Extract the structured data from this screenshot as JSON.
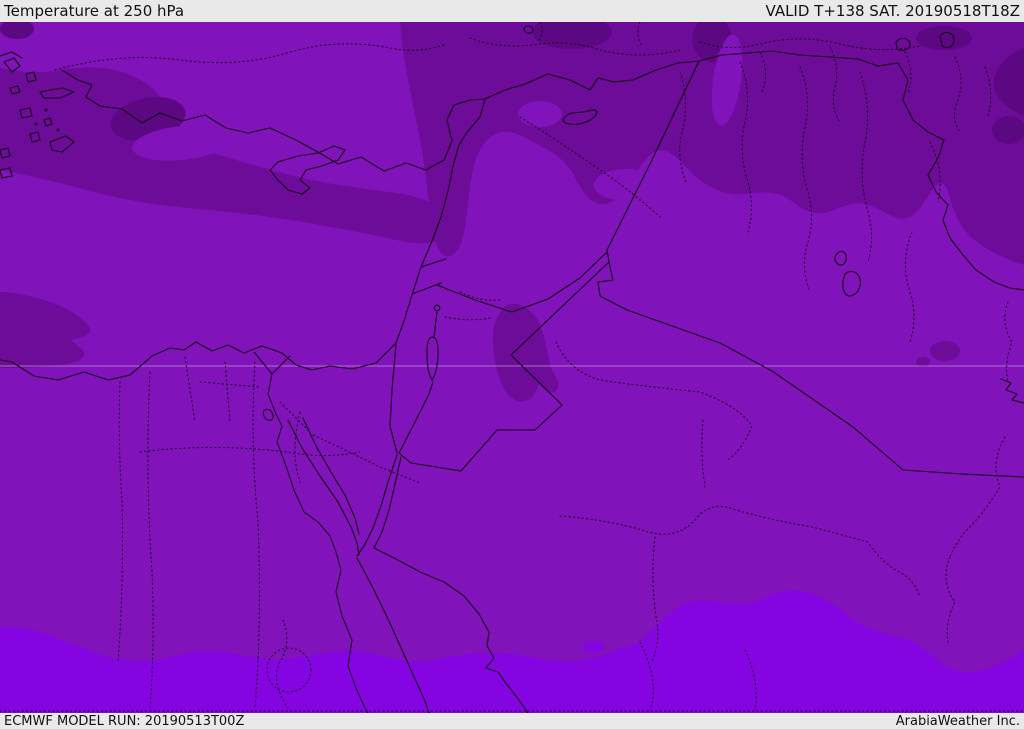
{
  "header": {
    "title": "Temperature at 250 hPa",
    "valid_label": "VALID T+138 SAT. 20190518T18Z"
  },
  "footer": {
    "model_run": "ECMWF MODEL RUN: 20190513T00Z",
    "credit": "ArabiaWeather Inc."
  },
  "map": {
    "kind": "filled-contour temperature field",
    "region": "Eastern Mediterranean / Middle East (Turkey, Cyprus, Levant, Egypt, Iraq, Saudi Arabia)",
    "temperature_bands_order": [
      "coldest-dark-purple",
      "cold-dark-purple",
      "base-purple",
      "warm-violet-south-band"
    ],
    "colors": {
      "base": "#8113BA",
      "dark": "#6D0C99",
      "darkest": "#5C0883",
      "warm_band": "#8504E2",
      "coastline": "#150016",
      "admin_dotted": "#1C041F",
      "header_bg": "#E9E9E9",
      "header_text": "#111111"
    }
  }
}
